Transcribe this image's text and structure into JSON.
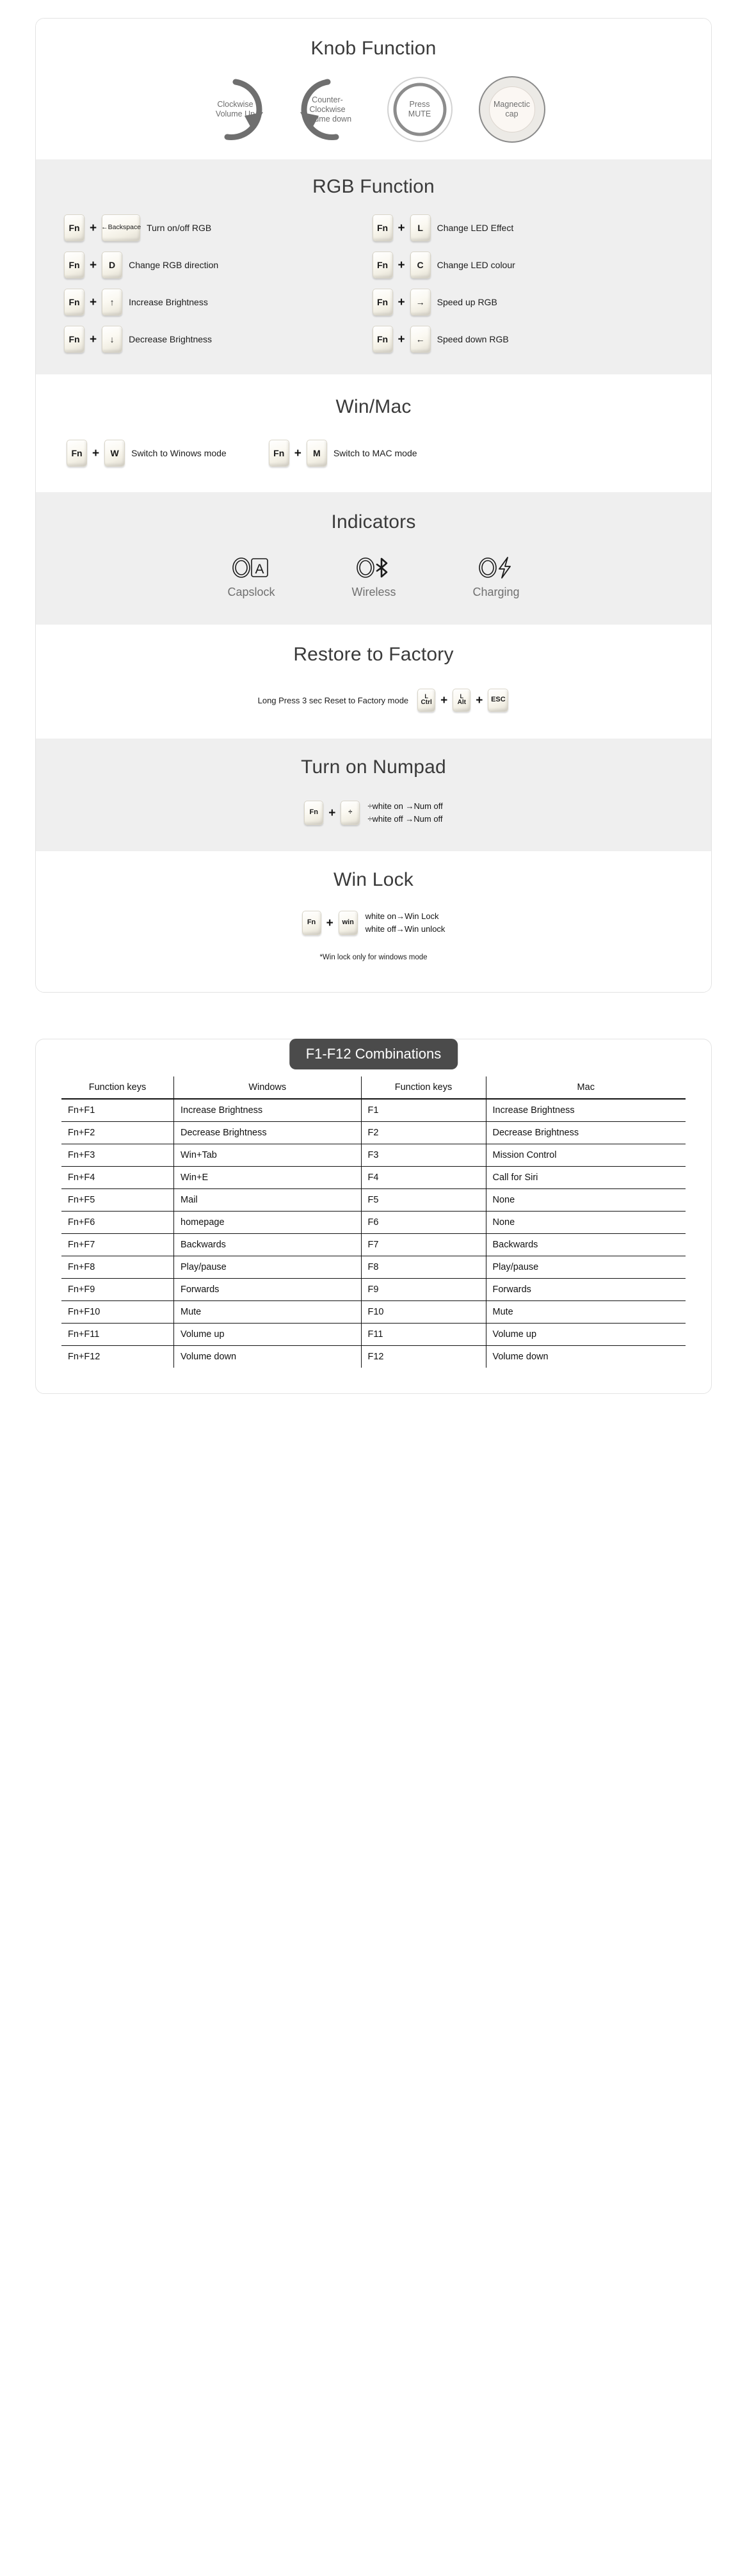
{
  "knob": {
    "title": "Knob Function",
    "items": [
      {
        "icon": "clockwise-rotate-icon",
        "line1": "Clockwise",
        "line2": "Volume Up"
      },
      {
        "icon": "counter-clockwise-rotate-icon",
        "line1": "Counter-",
        "line2": "Clockwise",
        "line3": "Volume down"
      },
      {
        "icon": "press-knob-icon",
        "line1": "Press",
        "line2": "MUTE"
      },
      {
        "icon": "magnetic-cap-icon",
        "line1": "Magnectic",
        "line2": "cap"
      }
    ]
  },
  "rgb": {
    "title": "RGB Function",
    "items": [
      {
        "mod": "Fn",
        "key": "←Backspace",
        "key_style": "wide",
        "action": "Turn on/off RGB"
      },
      {
        "mod": "Fn",
        "key": "L",
        "key_style": "std",
        "action": "Change LED Effect"
      },
      {
        "mod": "Fn",
        "key": "D",
        "key_style": "std",
        "action": "Change RGB direction"
      },
      {
        "mod": "Fn",
        "key": "C",
        "key_style": "std",
        "action": "Change LED colour"
      },
      {
        "mod": "Fn",
        "key": "↑",
        "key_style": "std",
        "action": "Increase Brightness"
      },
      {
        "mod": "Fn",
        "key": "→",
        "key_style": "std",
        "action": "Speed up RGB"
      },
      {
        "mod": "Fn",
        "key": "↓",
        "key_style": "std",
        "action": "Decrease Brightness"
      },
      {
        "mod": "Fn",
        "key": "←",
        "key_style": "std",
        "action": "Speed down RGB"
      }
    ]
  },
  "winmac": {
    "title": "Win/Mac",
    "items": [
      {
        "mod": "Fn",
        "key": "W",
        "action": "Switch to Winows mode"
      },
      {
        "mod": "Fn",
        "key": "M",
        "action": "Switch to MAC mode"
      }
    ]
  },
  "indicators": {
    "title": "Indicators",
    "items": [
      {
        "icon": "capslock-indicator-icon",
        "label": "Capslock"
      },
      {
        "icon": "bluetooth-wireless-icon",
        "label": "Wireless"
      },
      {
        "icon": "charging-bolt-icon",
        "label": "Charging"
      }
    ]
  },
  "restore": {
    "title": "Restore to Factory",
    "text": "Long Press 3 sec Reset to Factory mode",
    "keys": [
      {
        "top": "L",
        "bottom": "Ctrl"
      },
      {
        "top": "L",
        "bottom": "Alt"
      },
      {
        "top": "",
        "bottom": "ESC"
      }
    ]
  },
  "numpad": {
    "title": "Turn on Numpad",
    "mod": "Fn",
    "key": "÷",
    "line1": "÷white on  →Num off",
    "line2": "÷white off →Num off"
  },
  "winlock": {
    "title": "Win Lock",
    "mod": "Fn",
    "key": "win",
    "line1": "white on→Win Lock",
    "line2": "white off→Win unlock",
    "footnote": "*Win lock only for windows mode"
  },
  "fkeys": {
    "badge": "F1-F12 Combinations",
    "headers": [
      "Function keys",
      "Windows",
      "Function keys",
      "Mac"
    ],
    "rows": [
      [
        "Fn+F1",
        "Increase Brightness",
        "F1",
        "Increase Brightness"
      ],
      [
        "Fn+F2",
        "Decrease Brightness",
        "F2",
        "Decrease Brightness"
      ],
      [
        "Fn+F3",
        "Win+Tab",
        "F3",
        "Mission Control"
      ],
      [
        "Fn+F4",
        "Win+E",
        "F4",
        "Call for Siri"
      ],
      [
        "Fn+F5",
        "Mail",
        "F5",
        "None"
      ],
      [
        "Fn+F6",
        "homepage",
        "F6",
        "None"
      ],
      [
        "Fn+F7",
        "Backwards",
        "F7",
        "Backwards"
      ],
      [
        "Fn+F8",
        "Play/pause",
        "F8",
        "Play/pause"
      ],
      [
        "Fn+F9",
        "Forwards",
        "F9",
        "Forwards"
      ],
      [
        "Fn+F10",
        "Mute",
        "F10",
        "Mute"
      ],
      [
        "Fn+F11",
        "Volume up",
        "F11",
        "Volume up"
      ],
      [
        "Fn+F12",
        "Volume down",
        "F12",
        "Volume down"
      ]
    ]
  },
  "colors": {
    "shaded_bg": "#efefef",
    "card_bg": "#ffffff",
    "badge_bg": "#4b4b4b",
    "knob_stroke": "#6f6f6f",
    "title_color": "#3a3a3a",
    "indicator_label": "#707070",
    "magnetic_outer": "#eceae6",
    "magnetic_inner": "#fbf7f3"
  }
}
